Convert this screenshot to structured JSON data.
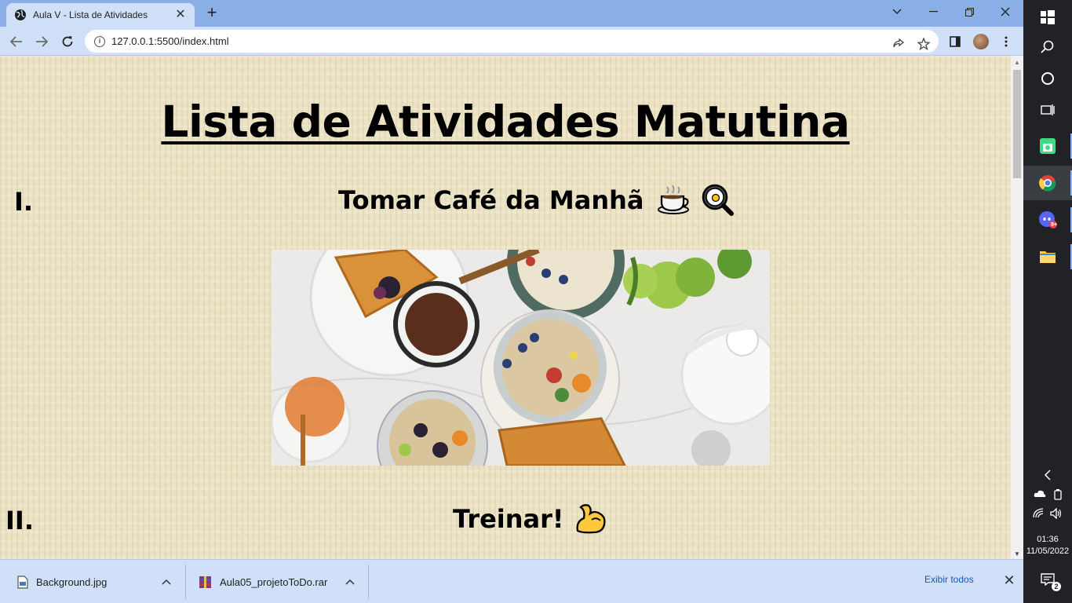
{
  "browser": {
    "tab_title": "Aula V - Lista de Atividades",
    "url": "127.0.0.1:5500/index.html"
  },
  "page": {
    "title": "Lista de Atividades Matutina",
    "items": [
      {
        "numeral": "I.",
        "title": "Tomar Café da Manhã"
      },
      {
        "numeral": "II.",
        "title": "Treinar!"
      }
    ]
  },
  "downloads": {
    "items": [
      {
        "name": "Background.jpg"
      },
      {
        "name": "Aula05_projetoToDo.rar"
      }
    ],
    "show_all": "Exibir todos"
  },
  "taskbar": {
    "time": "01:36",
    "date": "11/05/2022",
    "notification_count": "2",
    "discord_badge": "9+"
  }
}
